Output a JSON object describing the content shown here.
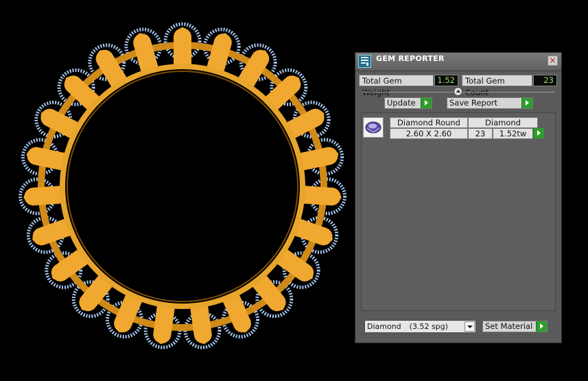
{
  "panel": {
    "title": "GEM REPORTER",
    "close_symbol": "×",
    "total_gem_weight_label": "Total Gem Weight",
    "total_gem_weight_value": "1.52",
    "total_gem_count_label": "Total Gem Count",
    "total_gem_count_value": "23",
    "update_label": "Update",
    "save_report_label": "Save Report",
    "gem_list": {
      "rows": [
        {
          "shape": "Diamond Round",
          "size": "2.60 X 2.60",
          "material": "Diamond",
          "count": "23",
          "weight": "1.52tw"
        }
      ]
    },
    "material_select": {
      "value": "Diamond",
      "spg": "(3.52 spg)"
    },
    "set_material_label": "Set Material"
  },
  "viewport": {
    "object": "eternity-ring",
    "metal_color": "#f0a830",
    "gem_wire_color": "#a9c8f0",
    "background_color": "#000000"
  },
  "icons": {
    "app": "gem-reporter-app-icon",
    "close": "close-icon",
    "arrow": "green-play-arrow-icon",
    "dropdown": "chevron-down-icon",
    "thumbnail": "round-diamond-icon"
  }
}
